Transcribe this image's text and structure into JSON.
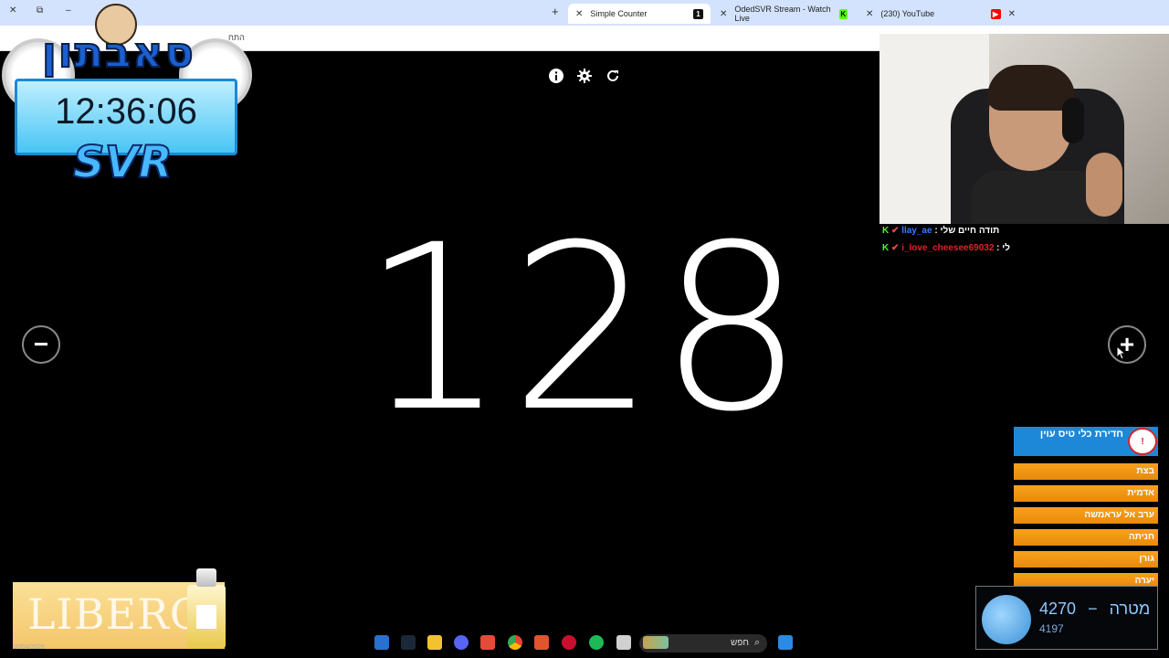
{
  "browser": {
    "tabs": [
      {
        "label": "Simple Counter",
        "active": true
      },
      {
        "label": "OdedSVR Stream - Watch Live",
        "active": false
      },
      {
        "label": "(230) YouTube",
        "active": false
      }
    ],
    "address_text": "התח"
  },
  "counter": {
    "value": "128",
    "minus_label": "−",
    "plus_label": "+"
  },
  "overlay": {
    "logo": "סאבתון",
    "clock": "12:36:06",
    "brand": "SVR"
  },
  "chat": [
    {
      "user": "llay_ae",
      "message": "תודה חיים שלי",
      "user_color": "#3b7bff"
    },
    {
      "user": "i_love_cheesee69032",
      "message": "לי",
      "user_color": "#e0222a"
    }
  ],
  "news": {
    "header": "חדירת כלי טיס עוין",
    "logo": "!",
    "items": [
      "בצת",
      "אדמית",
      "ערב אל עראמשה",
      "חניתה",
      "גורן",
      "יערה"
    ]
  },
  "goal": {
    "label": "מטרה",
    "target": "4270",
    "dash": "−",
    "current": "4197"
  },
  "ad": {
    "text": "LIBERO"
  },
  "taskbar": {
    "search_placeholder": "חפש",
    "date": "10/04/2026"
  },
  "colors": {
    "tab_bar": "#d3e3fd",
    "news_header": "#1e88d8",
    "news_item": "#f39a14",
    "kick_green": "#53fc18"
  },
  "icons": [
    "info-icon",
    "gear-icon",
    "refresh-icon",
    "minus-icon",
    "plus-icon",
    "search-icon"
  ]
}
